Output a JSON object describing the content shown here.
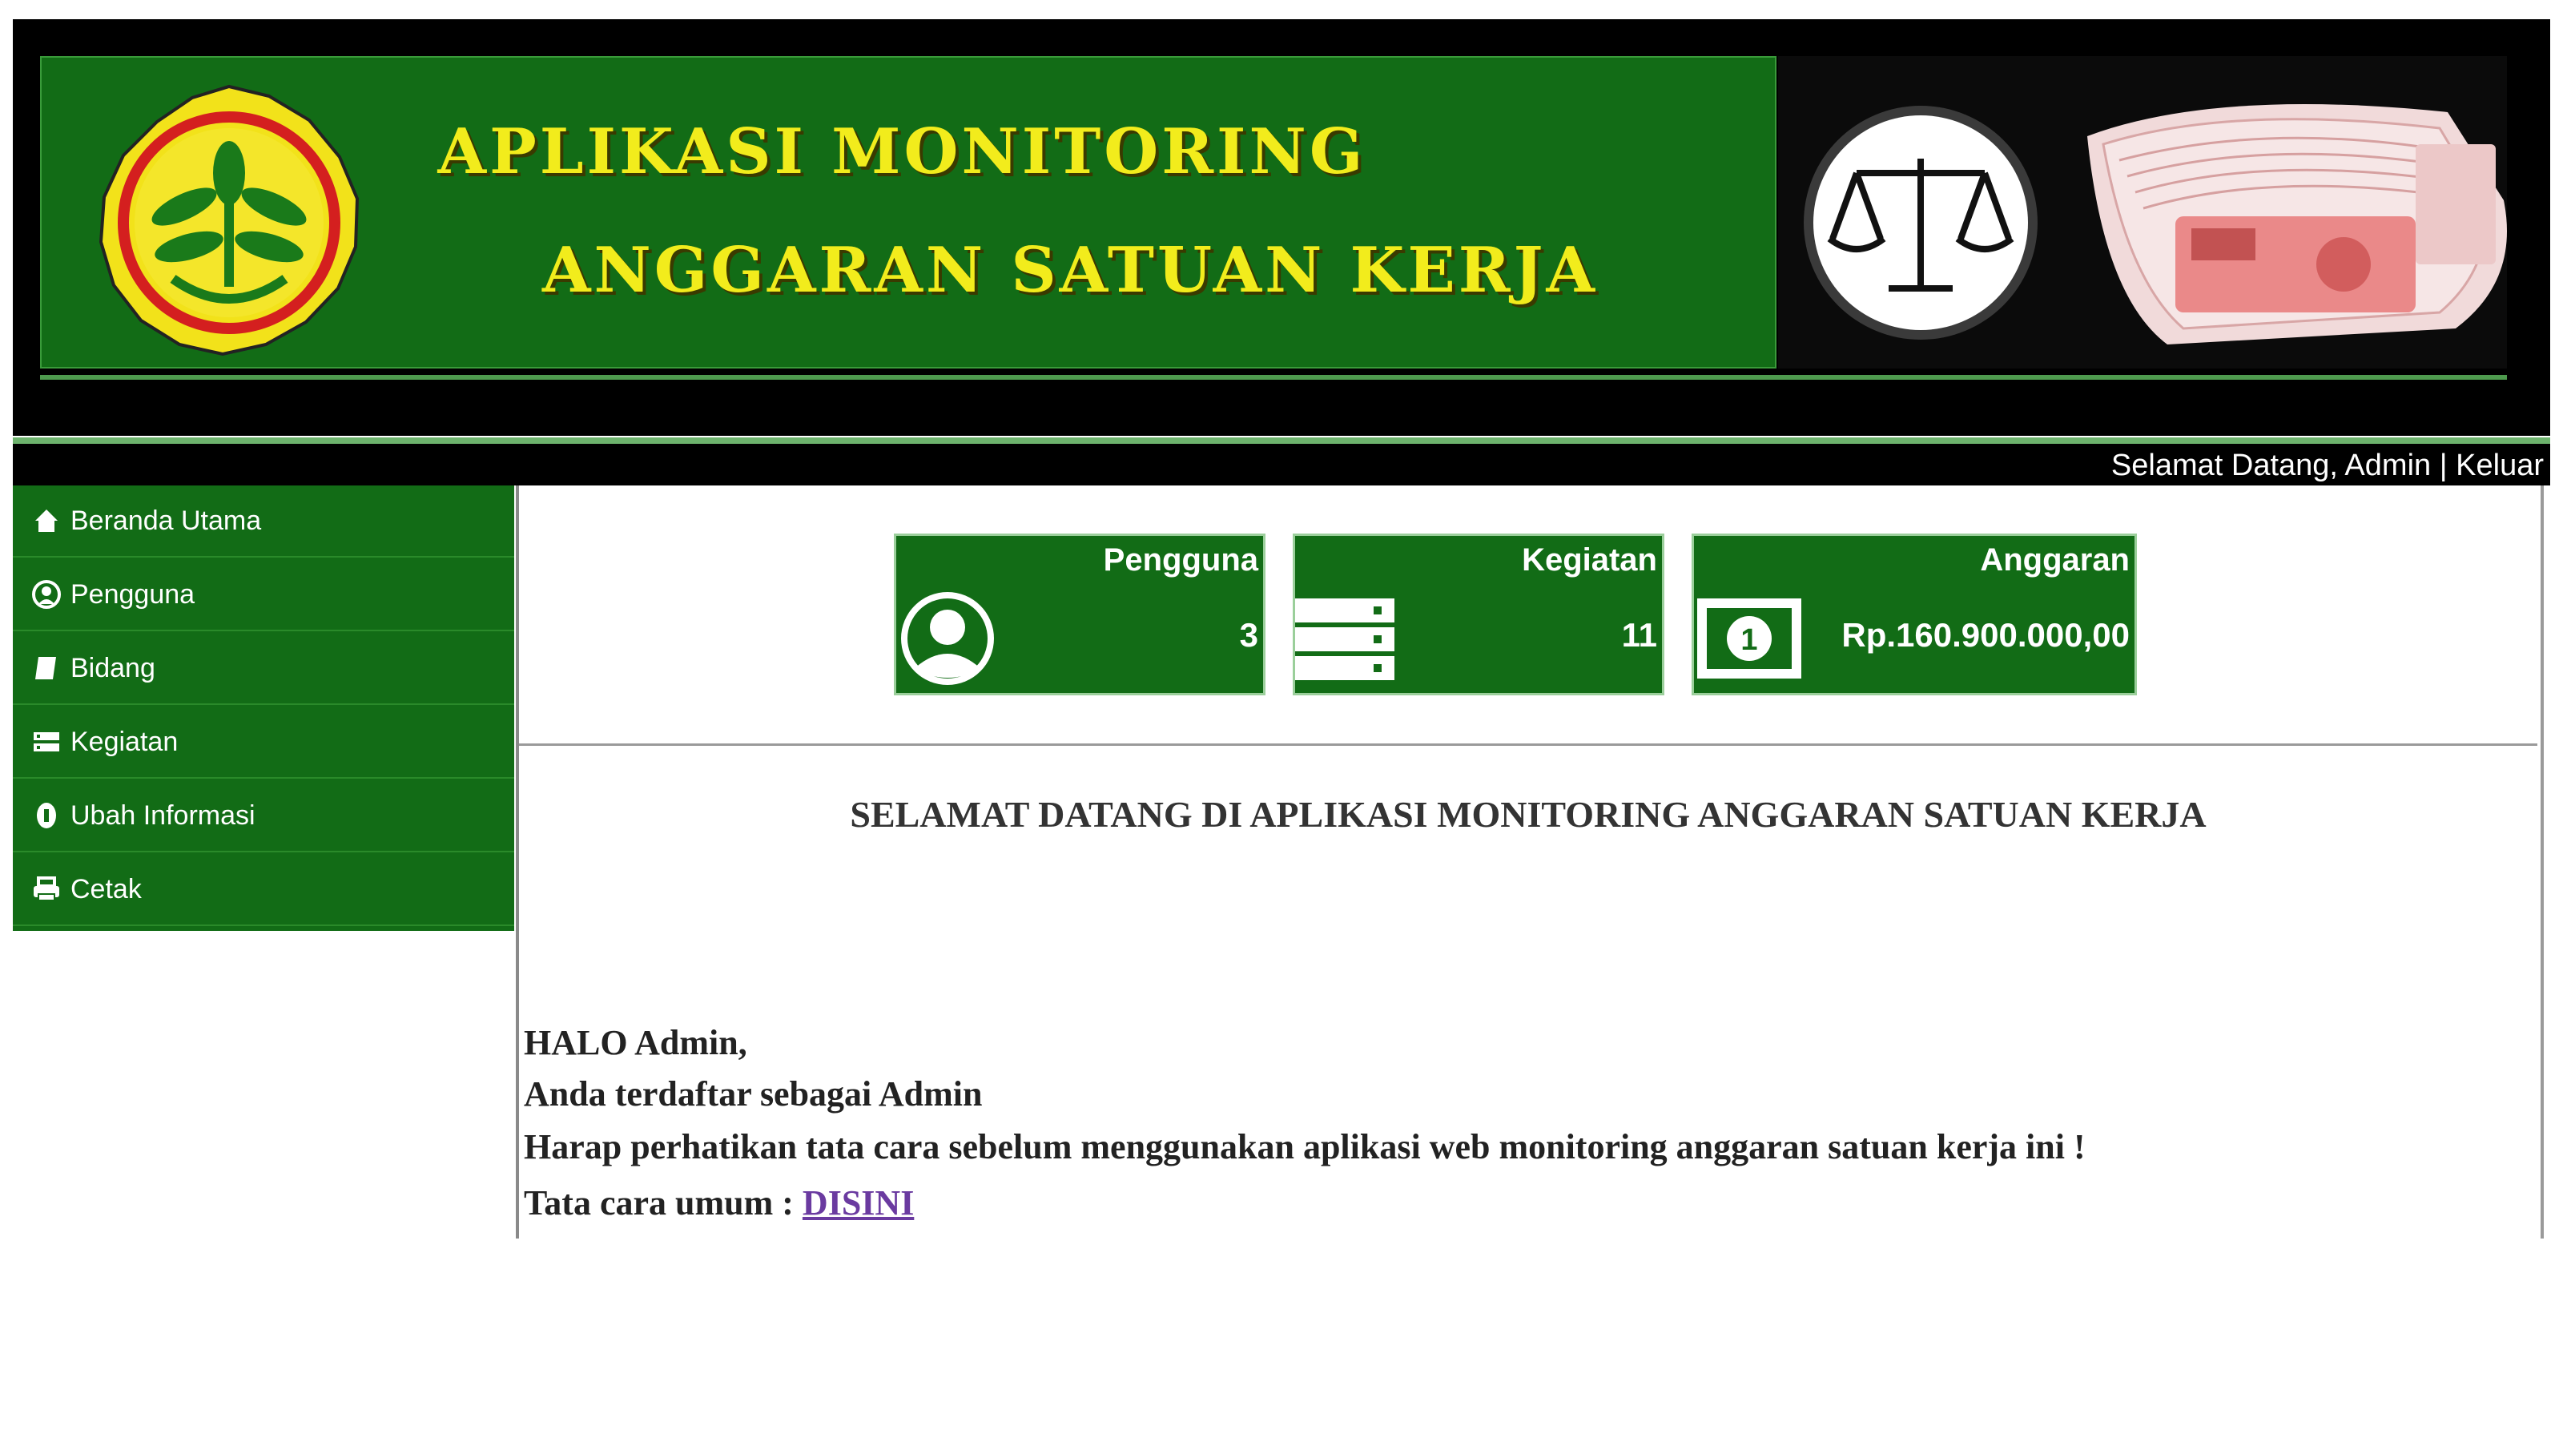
{
  "header": {
    "title_line1": "APLIKASI MONITORING",
    "title_line2": "ANGGARAN SATUAN KERJA",
    "logo_icon": "ministry-emblem-icon",
    "scale_icon": "scales-of-justice-icon",
    "money_image": "money-stack-image"
  },
  "welcome_bar": {
    "greeting": "Selamat Datang, Admin",
    "separator": "|",
    "logout": "Keluar"
  },
  "sidebar": {
    "items": [
      {
        "label": "Beranda Utama",
        "icon": "home-icon"
      },
      {
        "label": "Pengguna",
        "icon": "user-icon"
      },
      {
        "label": "Bidang",
        "icon": "book-icon"
      },
      {
        "label": "Kegiatan",
        "icon": "list-icon"
      },
      {
        "label": "Ubah Informasi",
        "icon": "info-icon"
      },
      {
        "label": "Cetak",
        "icon": "print-icon"
      }
    ]
  },
  "cards": [
    {
      "title": "Pengguna",
      "value": "3",
      "icon": "user-avatar-icon"
    },
    {
      "title": "Kegiatan",
      "value": "11",
      "icon": "server-icon"
    },
    {
      "title": "Anggaran",
      "value": "Rp.160.900.000,00",
      "icon": "banknote-icon"
    }
  ],
  "main": {
    "heading": "SELAMAT DATANG DI APLIKASI MONITORING ANGGARAN SATUAN KERJA",
    "line1": "HALO Admin,",
    "line2": "Anda terdaftar sebagai Admin",
    "line3": "Harap perhatikan tata cara sebelum menggunakan aplikasi web monitoring anggaran satuan kerja ini !",
    "line4_prefix": "Tata cara umum : ",
    "line4_link": "DISINI"
  },
  "colors": {
    "green": "#126c16",
    "yellow_title": "#f2ec1c",
    "link": "#6a3aa0"
  }
}
